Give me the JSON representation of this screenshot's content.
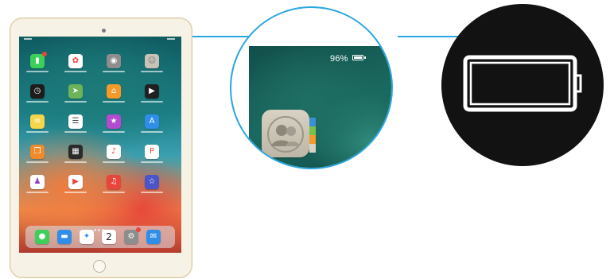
{
  "colors": {
    "arrow": "#2aa6e0",
    "device_frame": "#f7f2e6",
    "device_bezel": "#d8c9a4",
    "zoom_wallpaper": "#1a6a60",
    "badge_red": "#e8453c",
    "circle_background": "#121212",
    "battery_outline": "#ffffff"
  },
  "device": {
    "model": "ipad",
    "screen_icons": [
      "facetime-icon",
      "photos-icon",
      "camera-icon",
      "contacts-icon",
      "clock-icon",
      "maps-icon",
      "home-app-icon",
      "videos-icon",
      "notes-icon",
      "reminders-icon",
      "itunes-store-icon",
      "app-store-icon",
      "books-icon",
      "calculator-icon",
      "music-icon",
      "pinterest-icon",
      "podcasts-icon",
      "youtube-icon",
      "garageband-icon",
      "imovie-icon"
    ],
    "dock_icons": [
      "messages-icon",
      "files-icon",
      "safari-icon",
      "calendar-icon",
      "settings-icon",
      "mail-icon"
    ],
    "calendar_day": "2"
  },
  "zoom": {
    "battery_percent_text": "96%",
    "battery_level": 0.96,
    "app_icon": "contacts-icon"
  },
  "battery_icon": {
    "icon": "battery-outline-icon"
  }
}
